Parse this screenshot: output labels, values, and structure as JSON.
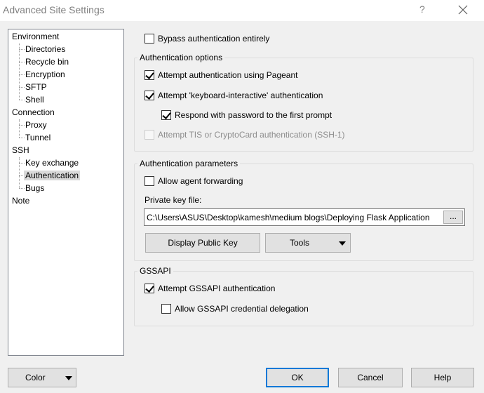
{
  "window": {
    "title": "Advanced Site Settings",
    "help_glyph": "?",
    "close_icon": "close-icon"
  },
  "tree": {
    "items": [
      {
        "label": "Environment",
        "level": 0
      },
      {
        "label": "Directories",
        "level": 1
      },
      {
        "label": "Recycle bin",
        "level": 1
      },
      {
        "label": "Encryption",
        "level": 1
      },
      {
        "label": "SFTP",
        "level": 1
      },
      {
        "label": "Shell",
        "level": 1
      },
      {
        "label": "Connection",
        "level": 0
      },
      {
        "label": "Proxy",
        "level": 1
      },
      {
        "label": "Tunnel",
        "level": 1
      },
      {
        "label": "SSH",
        "level": 0
      },
      {
        "label": "Key exchange",
        "level": 1
      },
      {
        "label": "Authentication",
        "level": 1,
        "selected": true
      },
      {
        "label": "Bugs",
        "level": 1
      },
      {
        "label": "Note",
        "level": 0
      }
    ]
  },
  "bypass": {
    "label": "Bypass authentication entirely",
    "checked": false
  },
  "auth_options": {
    "title": "Authentication options",
    "pageant": {
      "label": "Attempt authentication using Pageant",
      "checked": true
    },
    "keyboard_interactive": {
      "label": "Attempt 'keyboard-interactive' authentication",
      "checked": true
    },
    "respond_password": {
      "label": "Respond with password to the first prompt",
      "checked": true
    },
    "tis": {
      "label": "Attempt TIS or CryptoCard authentication (SSH-1)",
      "checked": false,
      "disabled": true
    }
  },
  "auth_params": {
    "title": "Authentication parameters",
    "agent_forwarding": {
      "label": "Allow agent forwarding",
      "checked": false
    },
    "private_key_label": "Private key file:",
    "private_key_value": "C:\\Users\\ASUS\\Desktop\\kamesh\\medium blogs\\Deploying Flask Application",
    "browse_label": "...",
    "display_public_key_label": "Display Public Key",
    "tools_label": "Tools"
  },
  "gssapi": {
    "title": "GSSAPI",
    "attempt": {
      "label": "Attempt GSSAPI authentication",
      "checked": true
    },
    "delegation": {
      "label": "Allow GSSAPI credential delegation",
      "checked": false
    }
  },
  "footer": {
    "color_label": "Color",
    "ok_label": "OK",
    "cancel_label": "Cancel",
    "help_label": "Help"
  },
  "colors": {
    "window_bg": "#f0f0f0",
    "focus_border": "#0078d7",
    "disabled_text": "#8d8d8d"
  }
}
